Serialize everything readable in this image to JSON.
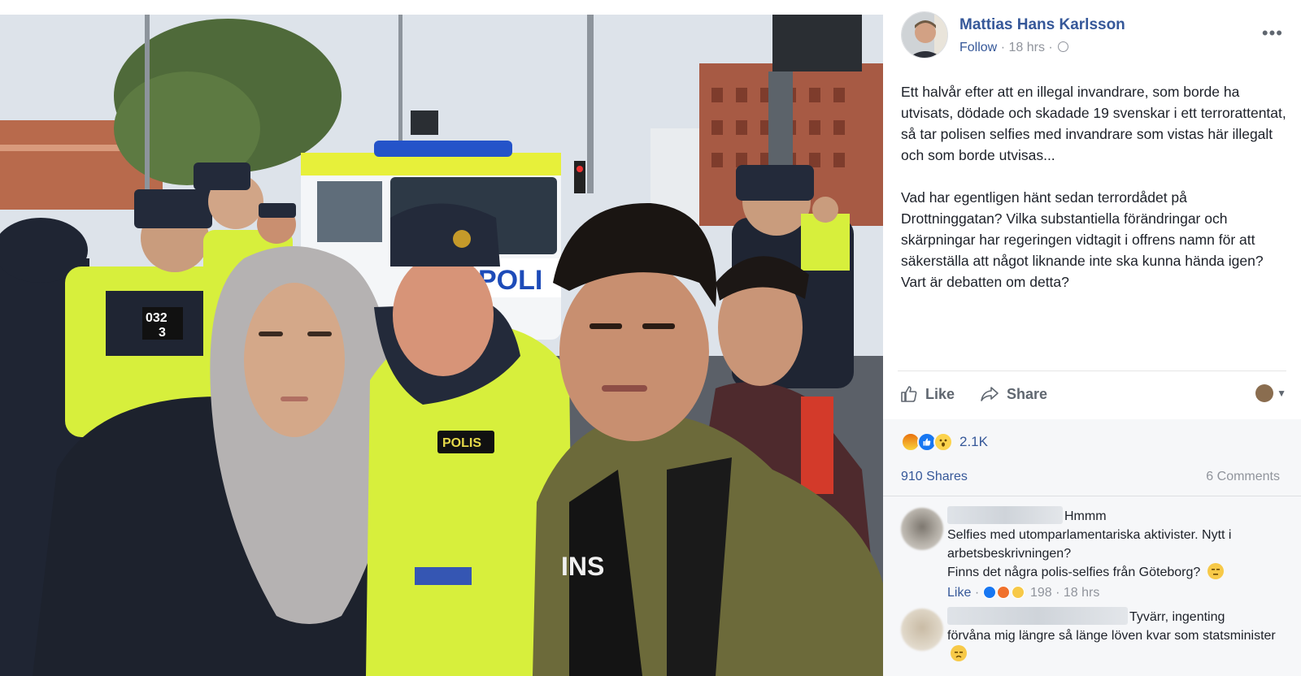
{
  "post": {
    "author": "Mattias Hans Karlsson",
    "follow_label": "Follow",
    "time": "18 hrs",
    "more_label": "•••",
    "paragraphs": [
      "Ett halvår efter att en illegal invandrare, som borde ha utvisats, dödade och skadade 19 svenskar i ett terrorattentat, så tar polisen selfies med invandrare som vistas här illegalt och som borde utvisas...",
      "Vad har egentligen hänt sedan terrordådet på Drottninggatan? Vilka substantiella förändringar och skärpningar har regeringen vidtagit i offrens namn för att säkerställa att något liknande inte ska kunna hända igen? Vart är debatten om detta?"
    ]
  },
  "actions": {
    "like_label": "Like",
    "share_label": "Share"
  },
  "feedback": {
    "reaction_count": "2.1K",
    "shares_label": "910 Shares",
    "comments_label": "6 Comments"
  },
  "photo": {
    "vest_label": "POLIS",
    "badge_number_top": "032",
    "badge_number_bottom": "3",
    "van_label": "POLI",
    "shirt_text": "INS"
  },
  "comments": [
    {
      "lines": [
        "Hmmm",
        "Selfies med utomparlamentariska aktivister. Nytt i arbetsbeskrivningen?",
        "Finns det några polis-selfies från Göteborg?"
      ],
      "like_label": "Like",
      "reaction_count": "198",
      "time": "18 hrs"
    },
    {
      "lines": [
        "Tyvärr, ingenting",
        "förvåna mig längre så länge löven kvar som statsminister"
      ]
    }
  ],
  "colors": {
    "link_blue": "#365899",
    "meta_gray": "#90949c",
    "feedback_bg": "#f6f7f9",
    "police_vest": "#d7ef3c",
    "police_navy": "#232a3a"
  }
}
